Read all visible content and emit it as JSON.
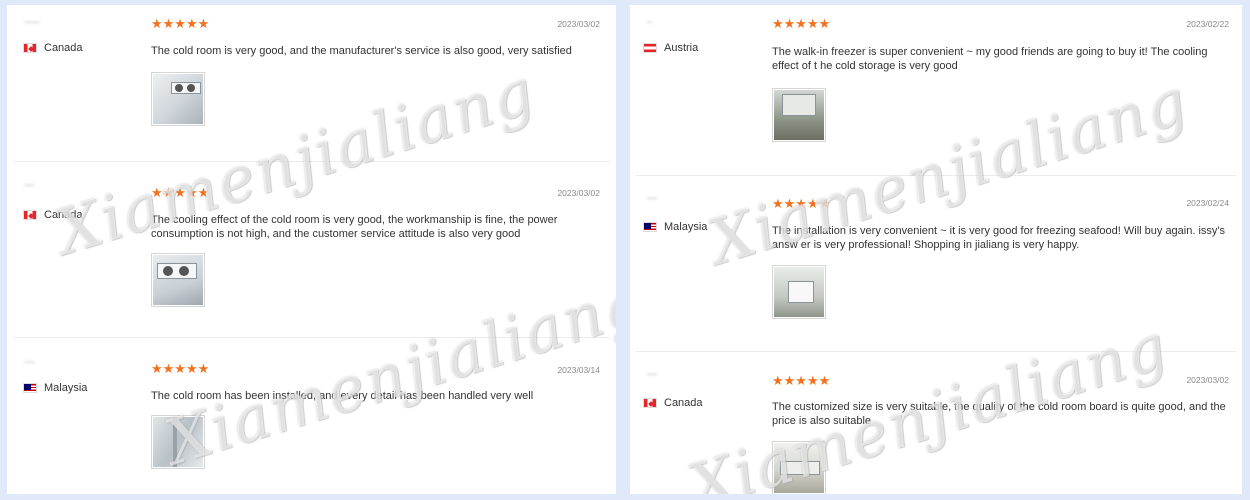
{
  "watermark_text": "Xiamenjialiang",
  "stars": "★★★★★",
  "left_reviews": [
    {
      "user": "~~~",
      "country": "Canada",
      "date": "2023/03/02",
      "text": "The cold room is very good, and the manufacturer's service is also good, very satisfied"
    },
    {
      "user": "~~",
      "country": "Canada",
      "date": "2023/03/02",
      "text": "The cooling effect of the cold room is very good, the workmanship is fine, the power consumption is not high, and the customer service attitude is also very good"
    },
    {
      "user": "~~",
      "country": "Malaysia",
      "date": "2023/03/14",
      "text": "The cold room has been installed, and every detail has been handled very well"
    }
  ],
  "right_reviews": [
    {
      "user": "~",
      "country": "Austria",
      "date": "2023/02/22",
      "text": "The walk-in freezer is super convenient ~ my good friends are going to buy it! The cooling effect of t he cold storage is very good"
    },
    {
      "user": "~~",
      "country": "Malaysia",
      "date": "2023/02/24",
      "text": "The installation is very convenient ~ it is very good for freezing seafood! Will buy again. issy's answ er is very professional! Shopping in jialiang is very happy."
    },
    {
      "user": "~~",
      "country": "Canada",
      "date": "2023/03/02",
      "text": "The customized size is very suitable, the quality of the cold room board is quite good, and the price is also suitable"
    }
  ]
}
